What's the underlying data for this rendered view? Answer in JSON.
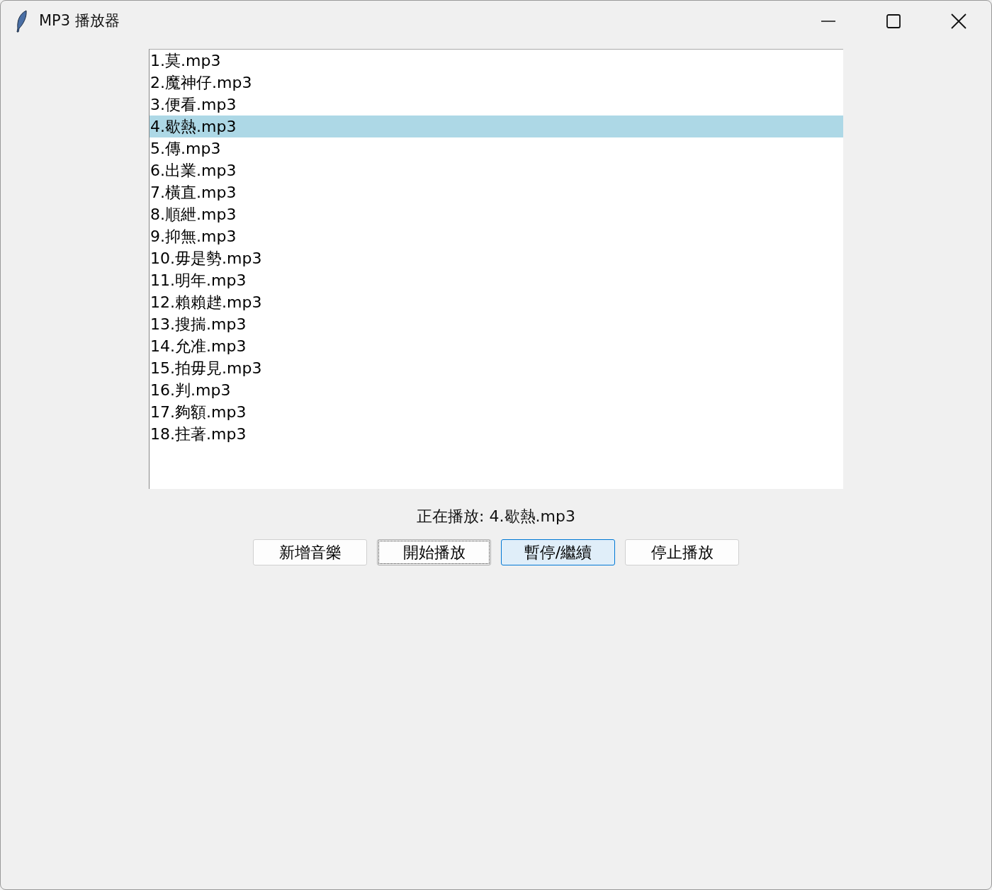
{
  "window": {
    "title": "MP3 播放器"
  },
  "playlist": [
    {
      "label": "1.莫.mp3",
      "selected": false
    },
    {
      "label": "2.魔神仔.mp3",
      "selected": false
    },
    {
      "label": "3.便看.mp3",
      "selected": false
    },
    {
      "label": "4.歇熱.mp3",
      "selected": true
    },
    {
      "label": "5.傳.mp3",
      "selected": false
    },
    {
      "label": "6.出業.mp3",
      "selected": false
    },
    {
      "label": "7.橫直.mp3",
      "selected": false
    },
    {
      "label": "8.順紲.mp3",
      "selected": false
    },
    {
      "label": "9.抑無.mp3",
      "selected": false
    },
    {
      "label": "10.毋是勢.mp3",
      "selected": false
    },
    {
      "label": "11.明年.mp3",
      "selected": false
    },
    {
      "label": "12.賴賴趖.mp3",
      "selected": false
    },
    {
      "label": "13.搜揣.mp3",
      "selected": false
    },
    {
      "label": "14.允准.mp3",
      "selected": false
    },
    {
      "label": "15.拍毋見.mp3",
      "selected": false
    },
    {
      "label": "16.判.mp3",
      "selected": false
    },
    {
      "label": "17.夠額.mp3",
      "selected": false
    },
    {
      "label": "18.拄著.mp3",
      "selected": false
    }
  ],
  "now_playing": "正在播放: 4.歇熱.mp3",
  "buttons": [
    {
      "label": "新增音樂",
      "focused": false,
      "hovered": false
    },
    {
      "label": "開始播放",
      "focused": true,
      "hovered": false
    },
    {
      "label": "暫停/繼續",
      "focused": false,
      "hovered": true
    },
    {
      "label": "停止播放",
      "focused": false,
      "hovered": false
    }
  ]
}
